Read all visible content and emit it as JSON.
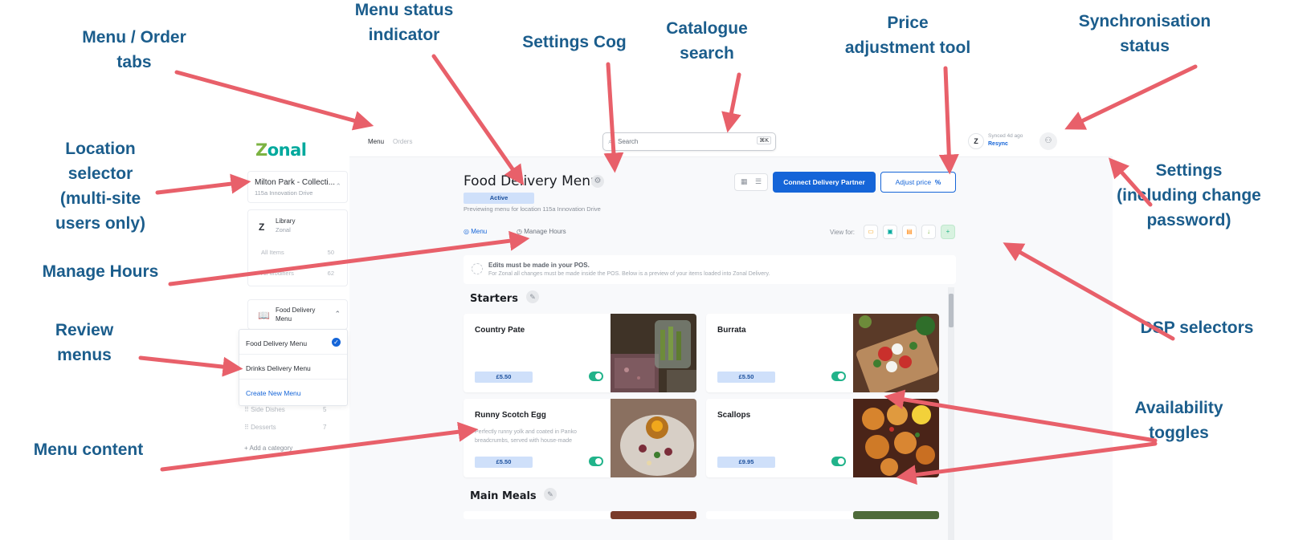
{
  "callouts": {
    "menu_order_tabs": "Menu / Order\ntabs",
    "menu_status_indicator": "Menu status\nindicator",
    "settings_cog": "Settings Cog",
    "catalogue_search": "Catalogue\nsearch",
    "price_adjustment_tool": "Price\nadjustment tool",
    "synchronisation_status": "Synchronisation\nstatus",
    "location_selector": "Location\nselector\n(multi-site\nusers only)",
    "settings": "Settings\n(including change\npassword)",
    "manage_hours": "Manage Hours",
    "review_menus": "Review\nmenus",
    "dsp_selectors": "DSP selectors",
    "availability_toggles": "Availability\ntoggles",
    "menu_content": "Menu content"
  },
  "colors": {
    "callout_text": "#1b5d8c",
    "arrow": "#e8606a",
    "primary": "#1565d8",
    "toggle_on": "#21b38a"
  },
  "sidebar": {
    "logo": {
      "z": "Z",
      "o": "o",
      "nal": "nal"
    },
    "location": {
      "name": "Milton Park - Collecti...",
      "address": "115a Innovation Drive"
    },
    "library": {
      "icon": "Z",
      "title": "Library",
      "subtitle": "Zonal",
      "rows": [
        {
          "label": "All Items",
          "count": "50"
        },
        {
          "label": "All Modifiers",
          "count": "62"
        }
      ]
    },
    "menu_group": {
      "label": "Food Delivery Menu"
    },
    "menus": [
      "Food Delivery Menu",
      "Drinks Delivery Menu"
    ],
    "create_menu": "Create New Menu",
    "categories": [
      {
        "label": "Side Dishes",
        "count": "5"
      },
      {
        "label": "Desserts",
        "count": "7"
      }
    ],
    "add_category": "+ Add a category"
  },
  "topbar": {
    "tabs": [
      "Menu",
      "Orders"
    ],
    "search": {
      "placeholder": "Search",
      "shortcut": "⌘K"
    },
    "sync": {
      "logo": "Z",
      "status": "Synced 4d ago",
      "action": "Resync"
    }
  },
  "page": {
    "title": "Food Delivery Menu",
    "status": "Active",
    "preview": "Previewing menu for location 115a Innovation Drive",
    "connect_button": "Connect Delivery Partner",
    "adjust_button": "Adjust price",
    "adjust_icon": "%",
    "subtabs": [
      "Menu",
      "Manage Hours"
    ],
    "view_for": "View for:"
  },
  "notice": {
    "title": "Edits must be made in your POS.",
    "body": "For Zonal all changes must be made inside the POS. Below is a preview of your items loaded into Zonal Delivery."
  },
  "sections": [
    {
      "title": "Starters",
      "items": [
        {
          "name": "Country Pate",
          "description": "",
          "price": "£5.50",
          "available": true
        },
        {
          "name": "Burrata",
          "description": "",
          "price": "£5.50",
          "available": true
        },
        {
          "name": "Runny Scotch Egg",
          "description": "Perfectly runny yolk and coated in Panko breadcrumbs, served with house-made",
          "price": "£5.50",
          "available": true
        },
        {
          "name": "Scallops",
          "description": "",
          "price": "£9.95",
          "available": true
        }
      ]
    },
    {
      "title": "Main Meals",
      "items": []
    }
  ]
}
